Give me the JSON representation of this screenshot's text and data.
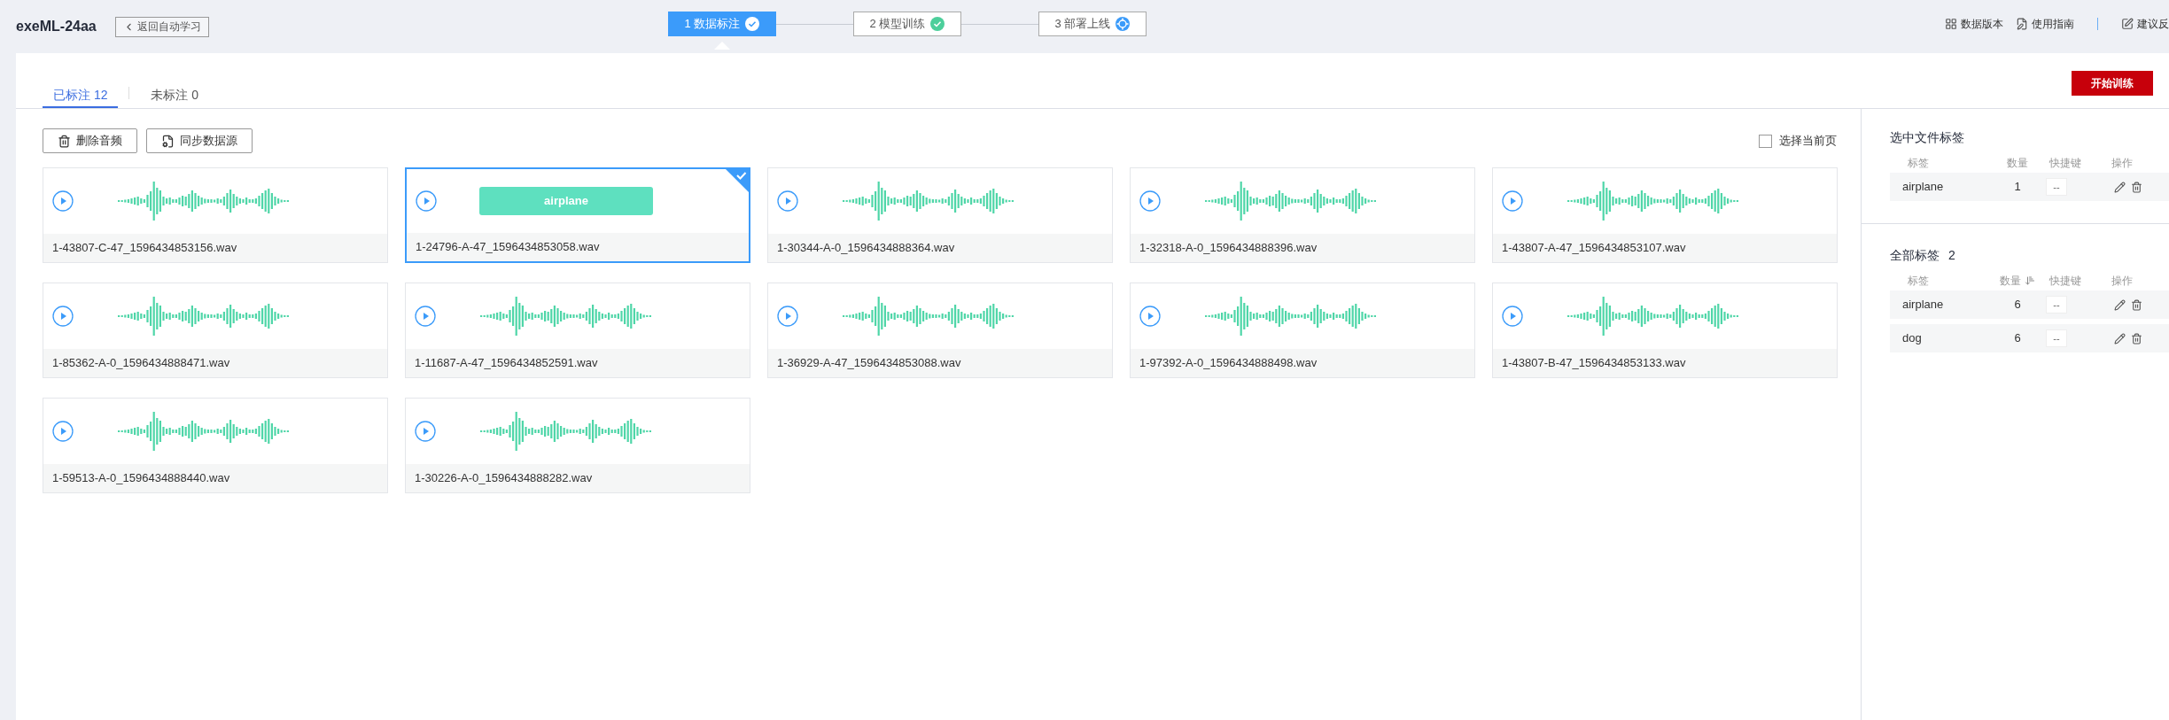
{
  "header": {
    "title": "exeML-24aa",
    "back_button": "返回自动学习",
    "steps": [
      {
        "label": "1 数据标注",
        "selected": true,
        "kind": "current"
      },
      {
        "label": "2 模型训练",
        "selected": false,
        "kind": "done"
      },
      {
        "label": "3 部署上线",
        "selected": false,
        "kind": "pending"
      }
    ],
    "links": [
      {
        "label": "数据版本",
        "kind": "grid"
      },
      {
        "label": "使用指南",
        "kind": "guide"
      },
      {
        "label": "建议反",
        "kind": "feedback"
      }
    ]
  },
  "tabs": [
    {
      "label": "已标注 12",
      "selected": true
    },
    {
      "label": "未标注 0",
      "selected": false
    }
  ],
  "train_button": "开始训练",
  "toolbar": {
    "buttons": [
      {
        "label": "删除音频",
        "kind": "delete"
      },
      {
        "label": "同步数据源",
        "kind": "sync"
      }
    ],
    "select_page": {
      "label": "选择当前页",
      "checked": false
    }
  },
  "files": [
    {
      "name": "1-43807-C-47_1596434853156.wav",
      "selected": false
    },
    {
      "name": "1-24796-A-47_1596434853058.wav",
      "selected": true,
      "label": "airplane"
    },
    {
      "name": "1-30344-A-0_1596434888364.wav",
      "selected": false
    },
    {
      "name": "1-32318-A-0_1596434888396.wav",
      "selected": false
    },
    {
      "name": "1-43807-A-47_1596434853107.wav",
      "selected": false
    },
    {
      "name": "1-85362-A-0_1596434888471.wav",
      "selected": false
    },
    {
      "name": "1-11687-A-47_1596434852591.wav",
      "selected": false
    },
    {
      "name": "1-36929-A-47_1596434853088.wav",
      "selected": false
    },
    {
      "name": "1-97392-A-0_1596434888498.wav",
      "selected": false
    },
    {
      "name": "1-43807-B-47_1596434853133.wav",
      "selected": false
    },
    {
      "name": "1-59513-A-0_1596434888440.wav",
      "selected": false
    },
    {
      "name": "1-30226-A-0_1596434888282.wav",
      "selected": false
    }
  ],
  "selected_file_labels": {
    "title": "选中文件标签",
    "columns": [
      {
        "label": "标签",
        "sortable": false
      },
      {
        "label": "数量",
        "sortable": false
      },
      {
        "label": "快捷键",
        "sortable": false
      },
      {
        "label": "操作",
        "sortable": false
      }
    ],
    "rows": [
      {
        "label": "airplane",
        "count": "1",
        "shortcut": "--"
      }
    ]
  },
  "all_labels": {
    "title": "全部标签",
    "count": "2",
    "columns": [
      {
        "label": "标签",
        "sortable": false
      },
      {
        "label": "数量",
        "sortable": true
      },
      {
        "label": "快捷键",
        "sortable": false
      },
      {
        "label": "操作",
        "sortable": false
      }
    ],
    "rows": [
      {
        "label": "airplane",
        "count": "6",
        "shortcut": "--"
      },
      {
        "label": "dog",
        "count": "6",
        "shortcut": "--"
      }
    ]
  }
}
